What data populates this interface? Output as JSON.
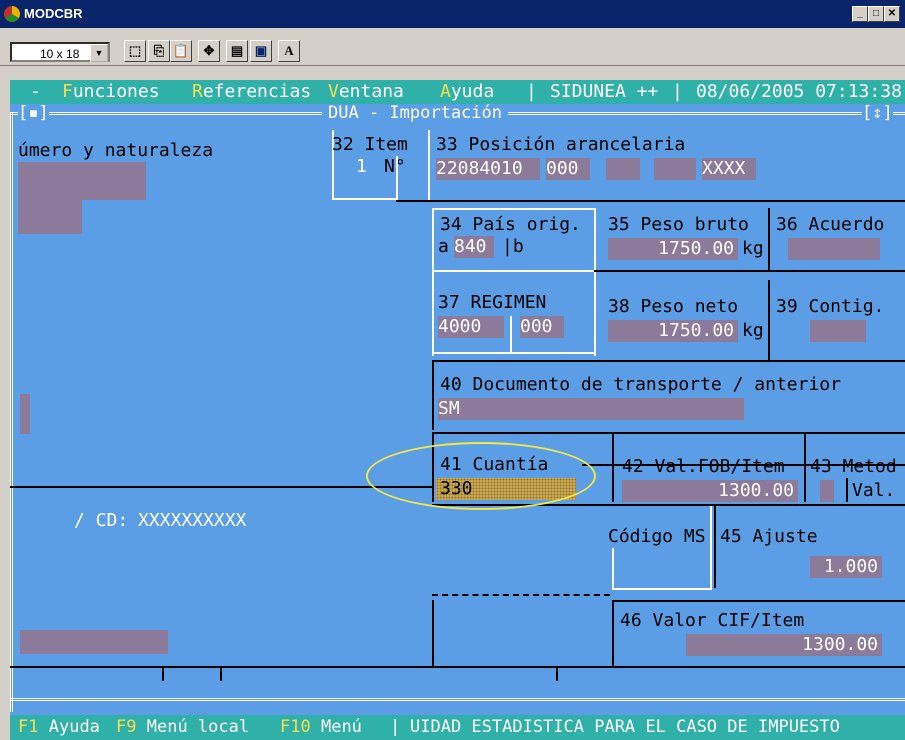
{
  "window": {
    "title": "MODCBR"
  },
  "toolbar": {
    "font_size": "10 x 18",
    "bold_label": "A"
  },
  "menu": {
    "dash": "-",
    "items": [
      {
        "hot": "F",
        "rest": "unciones"
      },
      {
        "hot": "R",
        "rest": "eferencias"
      },
      {
        "hot": "V",
        "rest": "entana"
      },
      {
        "hot": "A",
        "rest": "yuda"
      }
    ],
    "system": "SIDUNEA ++",
    "datetime": "08/06/2005 07:13:38"
  },
  "frame": {
    "left_marker": "[▪]",
    "title": "DUA - Importación",
    "right_marker": "[↕]"
  },
  "form": {
    "numero_label": "úmero y naturaleza",
    "item_label": "32 Item",
    "item_value": "1",
    "item_no": "N°",
    "posicion_label": "33 Posición arancelaria",
    "posicion_code": "22084010",
    "posicion_sub": "000",
    "posicion_xxxx": "XXXX",
    "pais_label": "34 País orig.",
    "pais_a": "a",
    "pais_value": "840",
    "pais_b": "|b",
    "peso_bruto_label": "35 Peso bruto",
    "peso_bruto_value": "1750.00",
    "kg1": "kg",
    "acuerdo_label": "36 Acuerdo",
    "regimen_label": "37 REGIMEN",
    "regimen_value": "4000",
    "regimen_sub": "000",
    "peso_neto_label": "38 Peso neto",
    "peso_neto_value": "1750.00",
    "kg2": "kg",
    "contig_label": "39 Contig.",
    "doc_label": "40 Documento de transporte / anterior",
    "doc_value": "SM",
    "cuantia_label": "41 Cuantía",
    "cuantia_value": "330",
    "valfob_label": "42 Val.FOB/Item",
    "valfob_value": "1300.00",
    "metod_label": "43 Metod",
    "val_label": "Val.",
    "cd_label": "/ CD:",
    "cd_value": "XXXXXXXXXX",
    "codigo_ms_label": "Código MS",
    "ajuste_label": "45 Ajuste",
    "ajuste_value": "1.000",
    "cif_label": "46 Valor CIF/Item",
    "cif_value": "1300.00"
  },
  "status": {
    "f1_key": "F1",
    "f1_label": "Ayuda",
    "f9_key": "F9",
    "f9_label": "Menú local",
    "f10_key": "F10",
    "f10_label": "Menú",
    "message": "UIDAD ESTADISTICA PARA EL CASO DE IMPUESTO"
  },
  "colors": {
    "screen_bg": "#5b9ee6",
    "menu_bg": "#2fb0a9",
    "field_bg": "#8b7a9a",
    "hotkey": "#f4e04a",
    "highlight": "#f0e64a"
  }
}
